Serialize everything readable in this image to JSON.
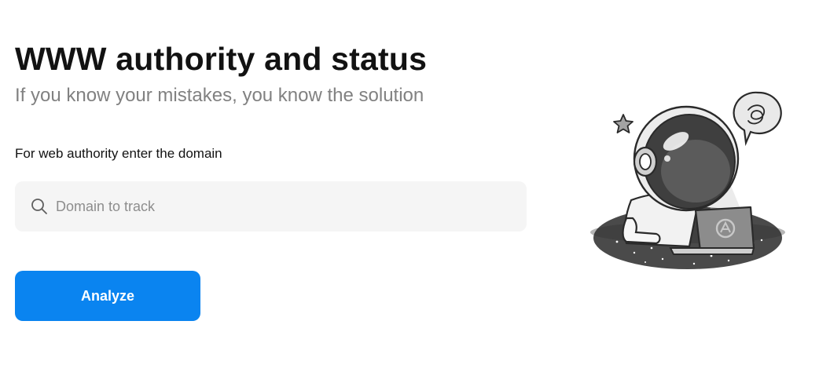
{
  "header": {
    "title": "WWW authority and status",
    "subtitle": "If you know your mistakes, you know the solution"
  },
  "form": {
    "label": "For web authority enter the domain",
    "search": {
      "placeholder": "Domain to track",
      "value": "",
      "icon": "search-icon"
    },
    "analyze_label": "Analyze"
  },
  "illustration": {
    "icons": [
      "star-icon",
      "speech-bubble-icon",
      "astronaut-illustration",
      "laptop-icon"
    ]
  },
  "colors": {
    "accent": "#0a84f0",
    "text": "#121212",
    "muted": "#818181",
    "input_bg": "#f5f5f5"
  }
}
